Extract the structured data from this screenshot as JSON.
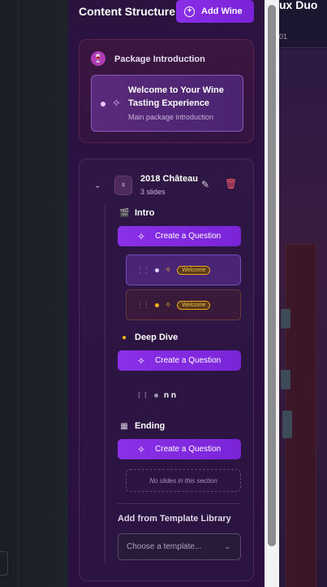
{
  "header": {
    "title": "Content Structure",
    "add_wine_label": "Add Wine"
  },
  "package_intro": {
    "label": "Package Introduction",
    "slide_title": "Welcome to Your Wine Tasting Experience",
    "slide_subtitle": "Main package introduction"
  },
  "wine": {
    "name": "2018 Château",
    "slide_count": "3 slides",
    "sections": {
      "intro": {
        "label": "Intro",
        "button": "Create a Question",
        "slides": [
          {
            "badge": "Welcome",
            "dot_color": "#e0d0ff"
          },
          {
            "badge": "Welcome",
            "dot_color": "#f0b020"
          }
        ]
      },
      "deep_dive": {
        "label": "Deep Dive",
        "button": "Create a Question",
        "slide_text": "n n"
      },
      "ending": {
        "label": "Ending",
        "button": "Create a Question",
        "empty_text": "No slides in this section"
      }
    }
  },
  "template_library": {
    "label": "Add from Template Library",
    "placeholder": "Choose a template..."
  },
  "right_panel": {
    "title": "ux Duo",
    "sub": "01"
  },
  "colors": {
    "accent": "#8a30e8",
    "danger": "#ff5a6a",
    "badge": "#f0b020"
  }
}
